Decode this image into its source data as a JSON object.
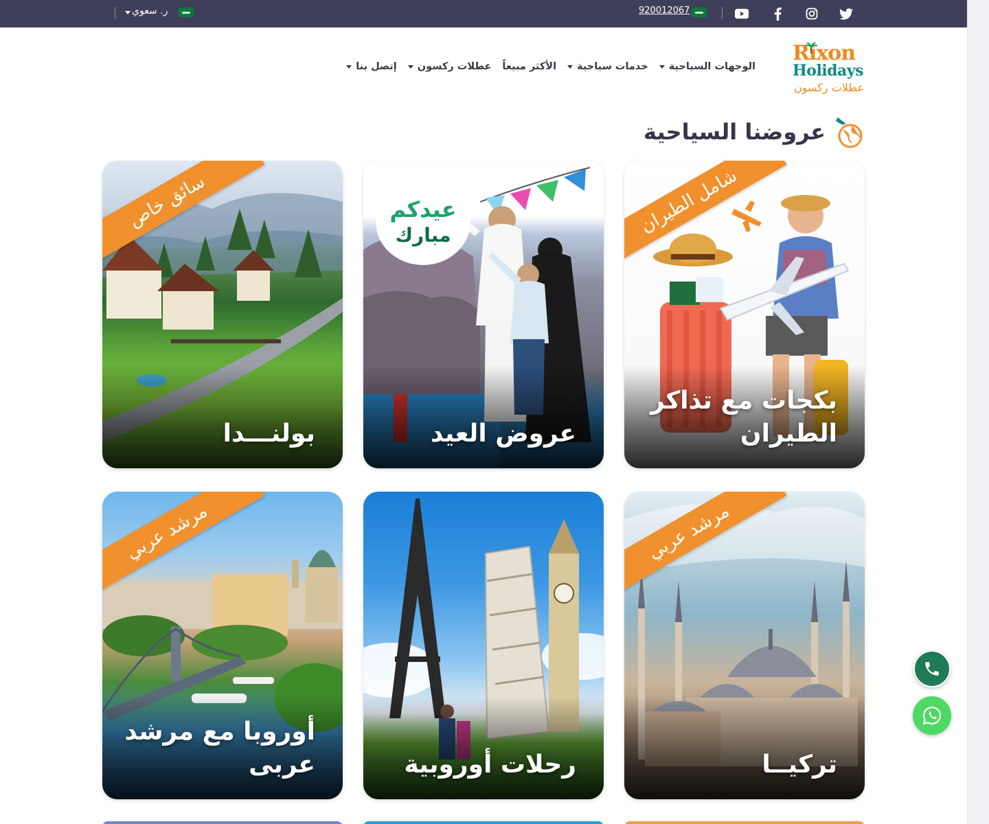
{
  "topbar": {
    "phone": "920012067",
    "currency": "ر. سعوي",
    "social_icons": [
      "twitter-icon",
      "instagram-icon",
      "facebook-icon",
      "youtube-icon"
    ]
  },
  "logo": {
    "line1": "Rixon",
    "line2": "Holidays",
    "arabic": "عطلات ركسون"
  },
  "nav": {
    "items": [
      {
        "label": "الوجهات السياحية",
        "has_dropdown": true
      },
      {
        "label": "خدمات سياحية",
        "has_dropdown": true
      },
      {
        "label": "الأكثر مبيعاً",
        "has_dropdown": false
      },
      {
        "label": "عطلات ركسون",
        "has_dropdown": true
      },
      {
        "label": "إتصل بنا",
        "has_dropdown": true
      }
    ]
  },
  "section": {
    "title": "عروضنا السياحية"
  },
  "cards": [
    {
      "title": "بكجات مع تذاكر الطيران",
      "ribbon": "شامل الطيران"
    },
    {
      "title": "عروض العيد",
      "ribbon": "",
      "greeting_line1": "عيدكم",
      "greeting_line2": "مبارك"
    },
    {
      "title": "بولنـــدا",
      "ribbon": "سائق خاص"
    },
    {
      "title": "تركيــا",
      "ribbon": "مرشد عربي"
    },
    {
      "title": "رحلات أوروبية",
      "ribbon": ""
    },
    {
      "title": "أوروبا مع مرشد عربى",
      "ribbon": "مرشد عربي"
    }
  ],
  "colors": {
    "topbar": "#3f3f5a",
    "accent_orange": "#f0912e",
    "teal": "#0f8a86",
    "phone_fab": "#1f7a57",
    "whatsapp_fab": "#4cd964"
  }
}
